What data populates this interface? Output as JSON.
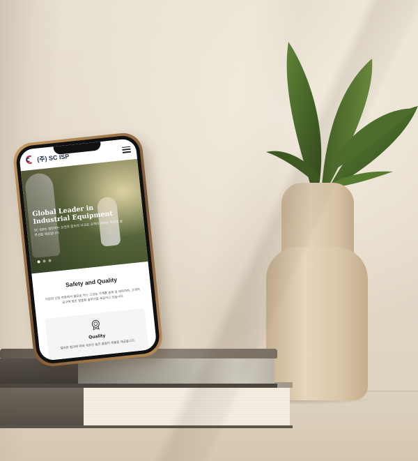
{
  "scene": {
    "colors": {
      "wall": "#e6ddcd",
      "vase": "#dcc9ac",
      "leaf": "#4b6a2a",
      "phone_frame": "#a87a46"
    }
  },
  "phone": {
    "logo": {
      "text": "(주) SC ISP",
      "icon": "sc-isp-logo-icon"
    },
    "header": {
      "menu_icon": "hamburger-menu-icon"
    },
    "hero": {
      "title_line1": "Global Leader in",
      "title_line2": "Industrial Equipment",
      "subtitle": "SC ISP는 정진하는 도전과 창의적 사고로 고객이 원하는 최상의 솔루션을 제공합니다.",
      "slide_count": 3,
      "active_slide": 1
    },
    "section": {
      "title": "Safety and Quality",
      "text": "다양한 산업 현장에서 필요로 하는 고성능 기계를 설계 및 제작하며, 고객의 요구에 맞춘 맞춤형 솔루션을 제공하고 있습니다."
    },
    "card": {
      "icon": "quality-badge-icon",
      "title": "Quality",
      "text": "철저한 협과에 따라 제조된 높은 품질의 제품을 제공합니다."
    }
  }
}
